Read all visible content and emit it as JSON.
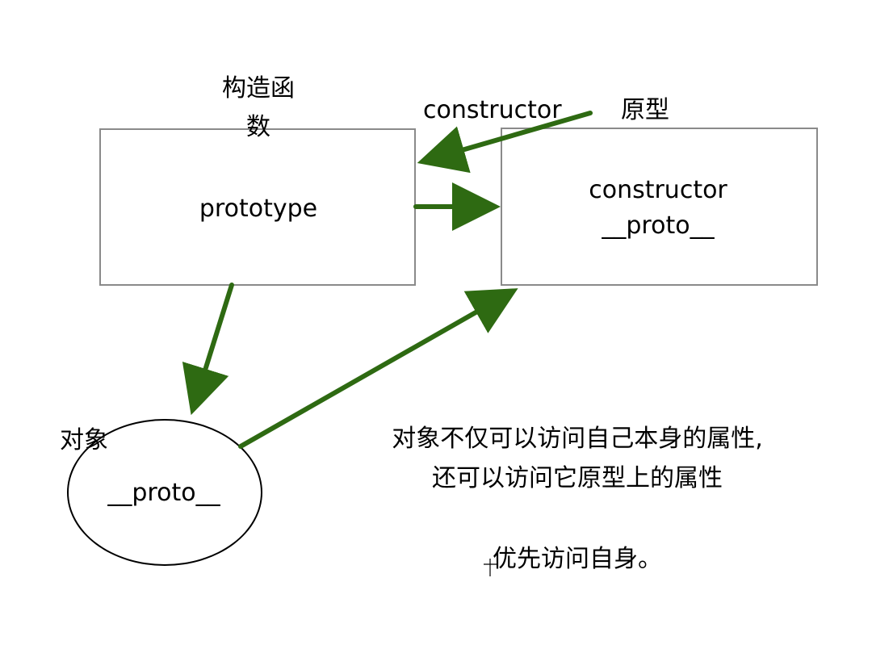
{
  "constructor_node": {
    "title_line1": "构造函",
    "title_line2": "数",
    "body": "prototype"
  },
  "prototype_node": {
    "title": "原型",
    "line1": "constructor",
    "line2": "__proto__"
  },
  "instance_node": {
    "title": "对象",
    "body": "__proto__"
  },
  "edge_labels": {
    "constructor_arrow": "constructor"
  },
  "notes": {
    "line1": "对象不仅可以访问自己本身的属性,",
    "line2": "还可以访问它原型上的属性",
    "line3": "优先访问自身。"
  },
  "colors": {
    "arrow": "#2e6a12",
    "box_border": "#8a8a8a",
    "ellipse_border": "#000000",
    "text": "#000000"
  }
}
